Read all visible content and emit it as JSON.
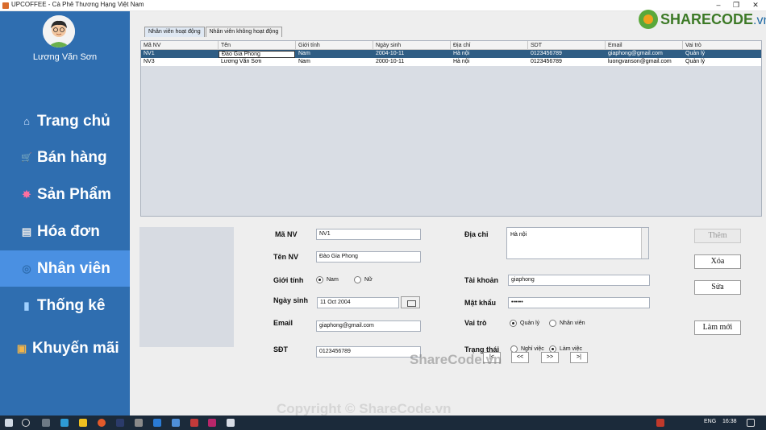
{
  "window": {
    "title": "UPCOFFEE - Cà Phê Thương Hạng Việt Nam",
    "controls": [
      "–",
      "❐",
      "✕"
    ]
  },
  "sidebar": {
    "user": "Lương Văn Sơn",
    "items": [
      {
        "label": "Trang chủ",
        "icon": "home-icon",
        "glyph": "⌂"
      },
      {
        "label": "Bán hàng",
        "icon": "basket-icon",
        "glyph": "🛒"
      },
      {
        "label": "Sản Phẩm",
        "icon": "product-icon",
        "glyph": "✸"
      },
      {
        "label": "Hóa đơn",
        "icon": "invoice-icon",
        "glyph": "▤"
      },
      {
        "label": "Nhân viên",
        "icon": "staff-icon",
        "glyph": "◎"
      },
      {
        "label": "Thống kê",
        "icon": "stats-icon",
        "glyph": "▮"
      },
      {
        "label": "Khuyến mãi",
        "icon": "promo-icon",
        "glyph": "▣"
      }
    ],
    "active_index": 4,
    "bg_color": "#2f6eb0",
    "active_color": "#4a90e2"
  },
  "tabs": [
    "Nhân viên hoạt động",
    "Nhân viên không hoạt động"
  ],
  "table": {
    "columns": [
      "Mã NV",
      "Tên",
      "Giới tính",
      "Ngày sinh",
      "Địa chỉ",
      "SDT",
      "Email",
      "Vai trò"
    ],
    "rows": [
      [
        "NV1",
        "Đào Gia Phong",
        "Nam",
        "2004-10-11",
        "Hà nội",
        "0123456789",
        "giaphong@gmail.com",
        "Quản lý"
      ],
      [
        "NV3",
        "Lương Văn Sơn",
        "Nam",
        "2000-10-11",
        "Hà nội",
        "0123456789",
        "luongvanson@gmail.com",
        "Quản lý"
      ]
    ],
    "selected_row": 0
  },
  "form": {
    "ma_nv_label": "Mã NV",
    "ma_nv": "NV1",
    "ten_nv_label": "Tên NV",
    "ten_nv": "Đào Gia Phong",
    "gioi_tinh_label": "Giới tính",
    "gender_male": "Nam",
    "gender_female": "Nữ",
    "ngay_sinh_label": "Ngày sinh",
    "ngay_sinh": "11 Oct 2004",
    "email_label": "Email",
    "email": "giaphong@gmail.com",
    "sdt_label": "SĐT",
    "sdt": "0123456789",
    "dia_chi_label": "Địa chỉ",
    "dia_chi": "Hà nội",
    "tai_khoan_label": "Tài khoản",
    "tai_khoan": "giaphong",
    "mat_khau_label": "Mật khẩu",
    "mat_khau": "••••••",
    "vai_tro_label": "Vai trò",
    "role_manager": "Quản lý",
    "role_staff": "Nhân viên",
    "trang_thai_label": "Trạng thái",
    "status_quit": "Nghỉ việc",
    "status_working": "Làm việc"
  },
  "buttons": {
    "them": "Thêm",
    "xoa": "Xóa",
    "sua": "Sửa",
    "lam_moi": "Làm mới",
    "first": "|<",
    "prev": "<<",
    "next": ">>",
    "last": ">|"
  },
  "logo": {
    "brand": "SHARECODE",
    "suffix": ".vn"
  },
  "watermark": "ShareCode.vn",
  "copyright": "Copyright © ShareCode.vn",
  "taskbar": {
    "lang": "ENG",
    "time": "16:38"
  }
}
